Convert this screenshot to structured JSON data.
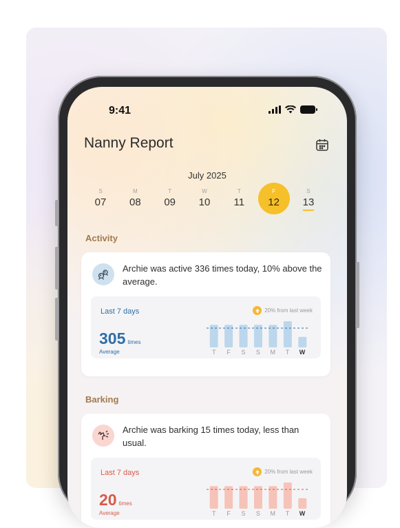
{
  "status_bar": {
    "time": "9:41",
    "icons": [
      "signal-icon",
      "wifi-icon",
      "battery-icon"
    ]
  },
  "header": {
    "title": "Nanny Report",
    "calendar_icon": "calendar-icon"
  },
  "calendar": {
    "month": "July 2025",
    "days": [
      {
        "dow": "S",
        "num": "07"
      },
      {
        "dow": "M",
        "num": "08"
      },
      {
        "dow": "T",
        "num": "09"
      },
      {
        "dow": "W",
        "num": "10"
      },
      {
        "dow": "T",
        "num": "11"
      },
      {
        "dow": "F",
        "num": "12"
      },
      {
        "dow": "S",
        "num": "13"
      }
    ],
    "selected_day": "12",
    "today": "13"
  },
  "activity": {
    "section_title": "Activity",
    "icon": "activity-icon",
    "message": "Archie was active 336 times today, 10% above the average.",
    "period_label": "Last 7 days",
    "change_text": "20% from last week",
    "value": "305",
    "unit": "times",
    "caption": "Average",
    "weekdays": [
      "T",
      "F",
      "S",
      "S",
      "M",
      "T",
      "W"
    ],
    "bar_levels": [
      0.82,
      0.82,
      0.82,
      0.82,
      0.82,
      0.95,
      0.38
    ],
    "accent": "#2f6ea6",
    "bar_color": "#bcd7ec",
    "icon_bg": "#cfe1ef"
  },
  "barking": {
    "section_title": "Barking",
    "icon": "barking-icon",
    "message": "Archie was barking 15 times today, less than usual.",
    "period_label": "Last 7 days",
    "change_text": "20% from last week",
    "value": "20",
    "unit": "times",
    "caption": "Average",
    "weekdays": [
      "T",
      "F",
      "S",
      "S",
      "M",
      "T",
      "W"
    ],
    "bar_levels": [
      0.82,
      0.82,
      0.82,
      0.82,
      0.82,
      0.95,
      0.38
    ],
    "accent": "#d85a4a",
    "bar_color": "#f6c3b9",
    "icon_bg": "#f9d6cf"
  },
  "colors": {
    "selected_day": "#f6c02a",
    "activity_title": "#a07a4f",
    "barking_title": "#a07a4f"
  }
}
